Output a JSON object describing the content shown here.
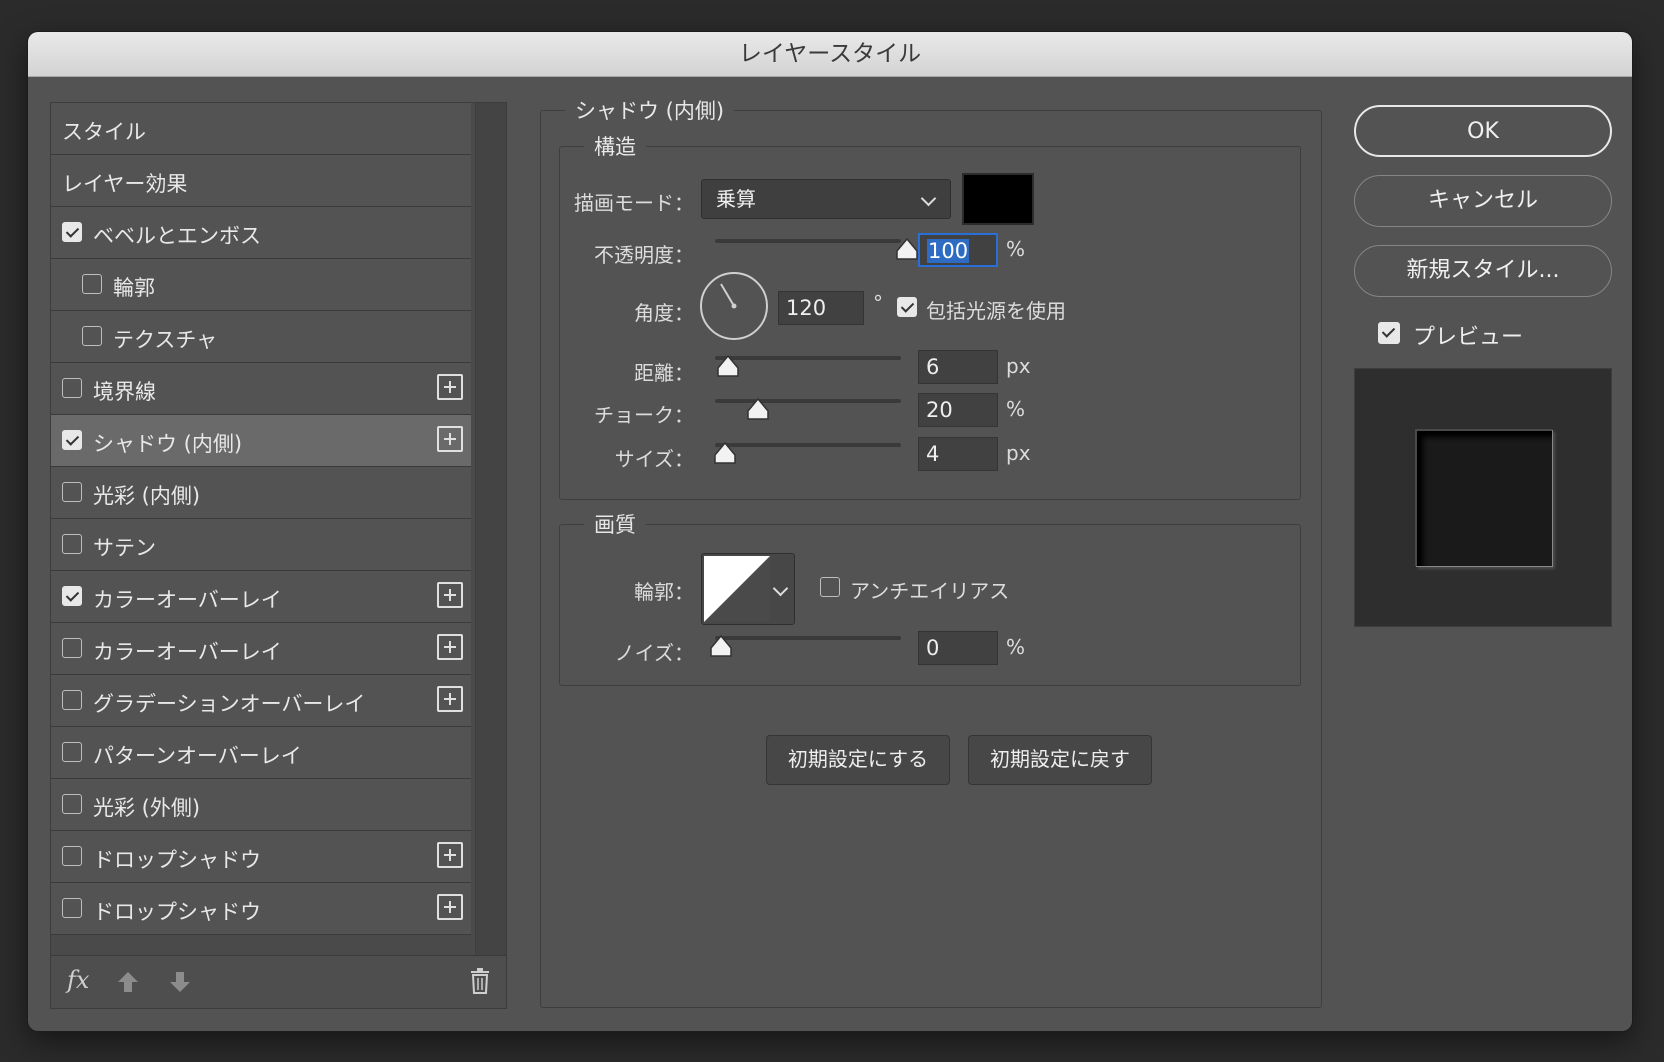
{
  "window": {
    "title": "レイヤースタイル"
  },
  "style_list": {
    "items": [
      {
        "label": "スタイル",
        "checkbox": false,
        "plus": false,
        "indent": false,
        "checked": false,
        "selected": false
      },
      {
        "label": "レイヤー効果",
        "checkbox": false,
        "plus": false,
        "indent": false,
        "checked": false,
        "selected": false
      },
      {
        "label": "ベベルとエンボス",
        "checkbox": true,
        "plus": false,
        "indent": false,
        "checked": true,
        "selected": false
      },
      {
        "label": "輪郭",
        "checkbox": true,
        "plus": false,
        "indent": true,
        "checked": false,
        "selected": false
      },
      {
        "label": "テクスチャ",
        "checkbox": true,
        "plus": false,
        "indent": true,
        "checked": false,
        "selected": false
      },
      {
        "label": "境界線",
        "checkbox": true,
        "plus": true,
        "indent": false,
        "checked": false,
        "selected": false
      },
      {
        "label": "シャドウ (内側)",
        "checkbox": true,
        "plus": true,
        "indent": false,
        "checked": true,
        "selected": true
      },
      {
        "label": "光彩 (内側)",
        "checkbox": true,
        "plus": false,
        "indent": false,
        "checked": false,
        "selected": false
      },
      {
        "label": "サテン",
        "checkbox": true,
        "plus": false,
        "indent": false,
        "checked": false,
        "selected": false
      },
      {
        "label": "カラーオーバーレイ",
        "checkbox": true,
        "plus": true,
        "indent": false,
        "checked": true,
        "selected": false
      },
      {
        "label": "カラーオーバーレイ",
        "checkbox": true,
        "plus": true,
        "indent": false,
        "checked": false,
        "selected": false
      },
      {
        "label": "グラデーションオーバーレイ",
        "checkbox": true,
        "plus": true,
        "indent": false,
        "checked": false,
        "selected": false
      },
      {
        "label": "パターンオーバーレイ",
        "checkbox": true,
        "plus": false,
        "indent": false,
        "checked": false,
        "selected": false
      },
      {
        "label": "光彩 (外側)",
        "checkbox": true,
        "plus": false,
        "indent": false,
        "checked": false,
        "selected": false
      },
      {
        "label": "ドロップシャドウ",
        "checkbox": true,
        "plus": true,
        "indent": false,
        "checked": false,
        "selected": false
      },
      {
        "label": "ドロップシャドウ",
        "checkbox": true,
        "plus": true,
        "indent": false,
        "checked": false,
        "selected": false
      }
    ],
    "footer": {
      "fx_label": "fx"
    }
  },
  "panel": {
    "title": "シャドウ (内側)",
    "structure": {
      "title": "構造",
      "blend_mode": {
        "label": "描画モード：",
        "value": "乗算",
        "color": "#000000"
      },
      "opacity": {
        "label": "不透明度：",
        "value": "100",
        "unit": "%",
        "fraction": 1.0
      },
      "angle": {
        "label": "角度：",
        "value": "120",
        "unit": "°",
        "global_light_label": "包括光源を使用",
        "global_light_checked": true
      },
      "distance": {
        "label": "距離：",
        "value": "6",
        "unit": "px",
        "fraction": 0.04
      },
      "choke": {
        "label": "チョーク：",
        "value": "20",
        "unit": "%",
        "fraction": 0.2
      },
      "size": {
        "label": "サイズ：",
        "value": "4",
        "unit": "px",
        "fraction": 0.02
      }
    },
    "quality": {
      "title": "画質",
      "contour": {
        "label": "輪郭：",
        "antialias_label": "アンチエイリアス",
        "antialias_checked": false
      },
      "noise": {
        "label": "ノイズ：",
        "value": "0",
        "unit": "%",
        "fraction": 0.0
      }
    },
    "buttons": {
      "make_default": "初期設定にする",
      "reset_default": "初期設定に戻す"
    }
  },
  "actions": {
    "ok": "OK",
    "cancel": "キャンセル",
    "new_style": "新規スタイル...",
    "preview_label": "プレビュー",
    "preview_checked": true
  }
}
